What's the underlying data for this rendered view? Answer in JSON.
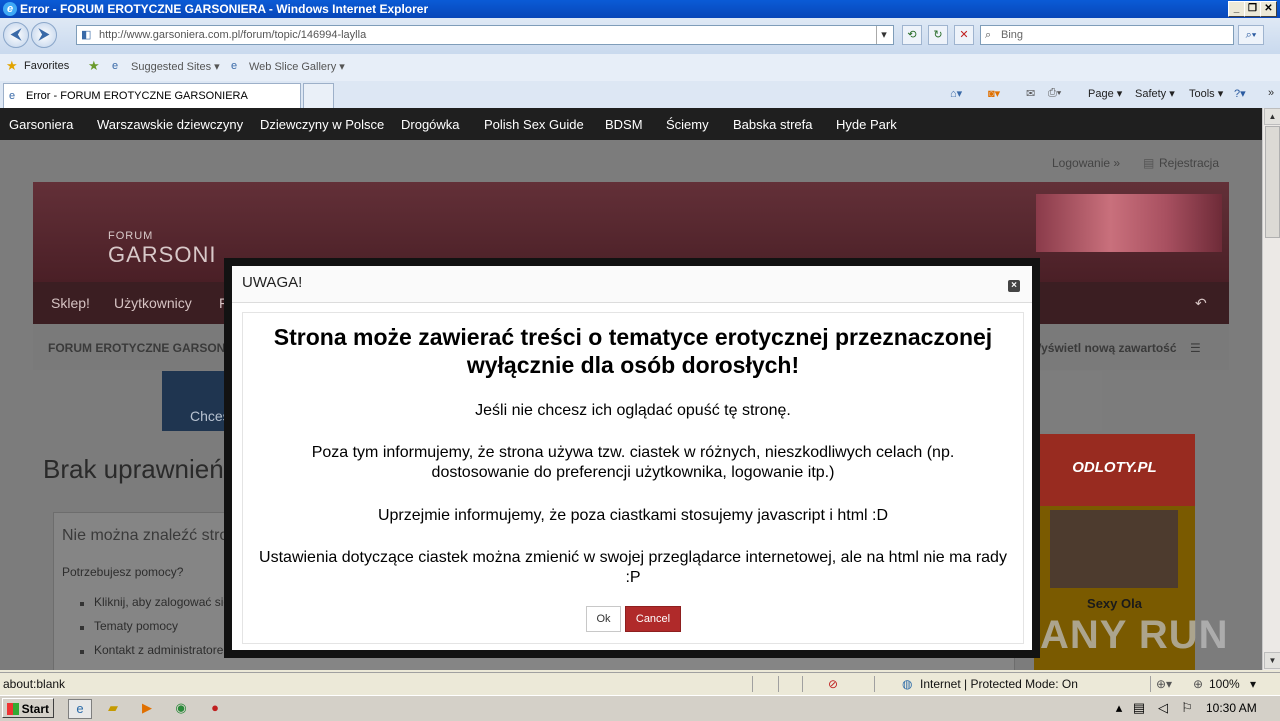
{
  "window": {
    "title": "Error - FORUM EROTYCZNE GARSONIERA - Windows Internet Explorer",
    "address": "http://www.garsoniera.com.pl/forum/topic/146994-laylla",
    "search_placeholder": "Bing"
  },
  "favorites_bar": {
    "favorites": "Favorites",
    "suggested": "Suggested Sites ▾",
    "webslice": "Web Slice Gallery ▾"
  },
  "tabs": [
    {
      "label": "Error - FORUM EROTYCZNE GARSONIERA"
    }
  ],
  "command_bar": {
    "page": "Page ▾",
    "safety": "Safety ▾",
    "tools": "Tools ▾"
  },
  "site_nav": [
    "Garsoniera",
    "Warszawskie dziewczyny",
    "Dziewczyny w Polsce",
    "Drogówka",
    "Polish Sex Guide",
    "BDSM",
    "Ściemy",
    "Babska strefa",
    "Hyde Park"
  ],
  "account": {
    "login": "Logowanie »",
    "register": "Rejestracja"
  },
  "logo": {
    "small": "FORUM",
    "big": "GARSONI"
  },
  "forum_menu": [
    "Sklep!",
    "Użytkownicy",
    "Fo"
  ],
  "breadcrumb": {
    "left": "FORUM EROTYCZNE GARSONIERA",
    "right": "Wyświetl nową zawartość"
  },
  "ad_text": "Chces",
  "page_title": "Brak uprawnień",
  "error_box": {
    "title": "Nie można znaleźć stron",
    "help": "Potrzebujesz pomocy?",
    "links": [
      "Kliknij, aby zalogować się",
      "Tematy pomocy",
      "Kontakt z administratorem forum"
    ]
  },
  "sidebar_ad": {
    "header": "ODLOTY.PL",
    "name": "Sexy Ola"
  },
  "watermark": "ANY RUN",
  "modal": {
    "title": "UWAGA!",
    "headline": "Strona może zawierać treści o tematyce erotycznej przeznaczonej wyłącznie dla osób dorosłych!",
    "p1": "Jeśli nie chcesz ich oglądać opuść tę stronę.",
    "p2": "Poza tym informujemy, że strona używa tzw. ciastek w różnych, nieszkodliwych celach (np. dostosowanie do preferencji użytkownika, logowanie itp.)",
    "p3": "Uprzejmie informujemy, że poza ciastkami stosujemy javascript i html :D",
    "p4": "Ustawienia dotyczące ciastek można zmienić w swojej przeglądarce internetowej, ale na html nie ma rady :P",
    "ok": "Ok",
    "cancel": "Cancel"
  },
  "status": {
    "left": "about:blank",
    "zone": "Internet | Protected Mode: On",
    "zoom": "100%"
  },
  "taskbar": {
    "start": "Start",
    "clock": "10:30 AM"
  }
}
